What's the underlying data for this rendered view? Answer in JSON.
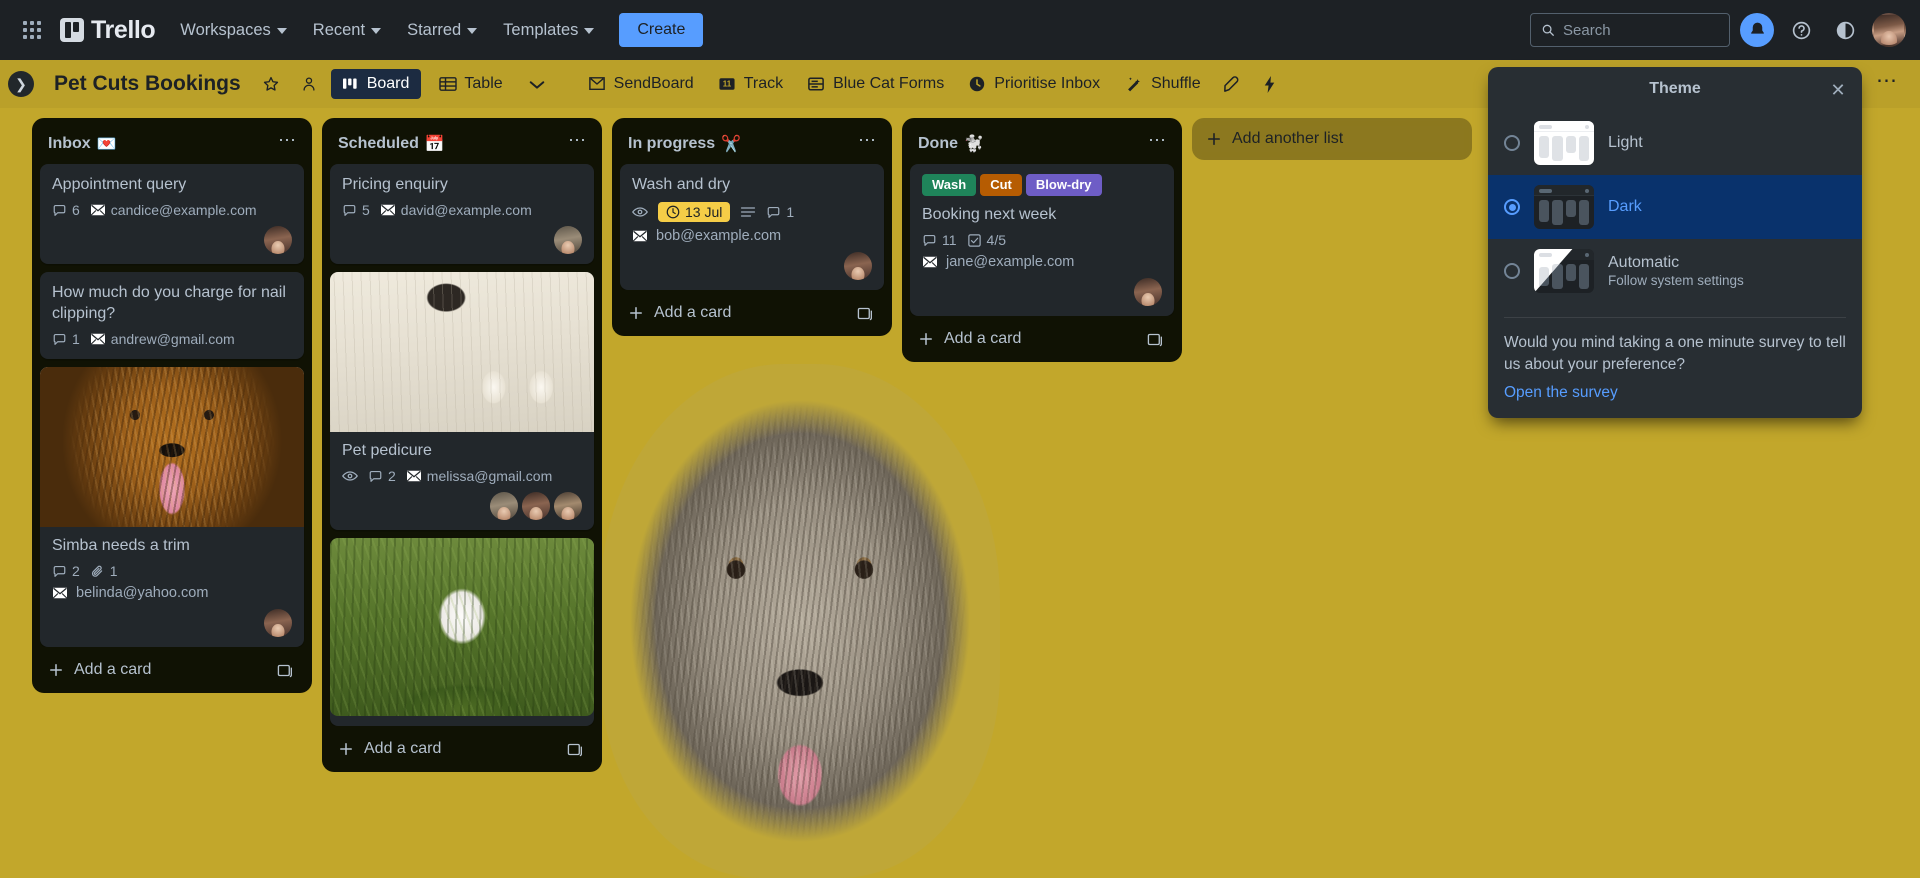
{
  "topnav": {
    "apps_icon": "grid-apps-icon",
    "brand": "Trello",
    "items": [
      {
        "label": "Workspaces",
        "has_chevron": true
      },
      {
        "label": "Recent",
        "has_chevron": true
      },
      {
        "label": "Starred",
        "has_chevron": true
      },
      {
        "label": "Templates",
        "has_chevron": true
      }
    ],
    "create_label": "Create",
    "search_placeholder": "Search",
    "search_value": "",
    "icons": {
      "notifications": "bell-icon",
      "help": "question-circle-icon",
      "theme": "half-circle-contrast-icon",
      "avatar": "user-avatar"
    }
  },
  "board_header": {
    "sidebar_toggle": "chevron-right-icon",
    "title": "Pet Cuts Bookings",
    "star_icon": "star-icon",
    "visibility_icon": "workspace-visible-icon",
    "views": [
      {
        "label": "Board",
        "icon": "board-icon",
        "selected": true
      },
      {
        "label": "Table",
        "icon": "table-icon",
        "selected": false
      }
    ],
    "views_chevron": "chevron-down-icon",
    "power_ups": [
      {
        "label": "SendBoard",
        "icon": "sendboard-icon"
      },
      {
        "label": "Track",
        "icon": "track-11-icon"
      },
      {
        "label": "Blue Cat Forms",
        "icon": "forms-icon"
      },
      {
        "label": "Prioritise Inbox",
        "icon": "clock-icon"
      },
      {
        "label": "Shuffle",
        "icon": "magic-wand-icon"
      }
    ],
    "trailing_icons": [
      {
        "name": "rocket-icon"
      },
      {
        "name": "lightning-automation-icon"
      }
    ],
    "more_menu": "board-menu-dots"
  },
  "theme_popup": {
    "title": "Theme",
    "close_icon": "close-icon",
    "options": [
      {
        "id": "light",
        "label": "Light",
        "sublabel": "",
        "selected": false
      },
      {
        "id": "dark",
        "label": "Dark",
        "sublabel": "",
        "selected": true
      },
      {
        "id": "automatic",
        "label": "Automatic",
        "sublabel": "Follow system settings",
        "selected": false
      }
    ],
    "survey_text": "Would you mind taking a one minute survey to tell us about your preference?",
    "survey_link": "Open the survey"
  },
  "board": {
    "background_color": "#c2a72b",
    "add_list_label": "Add another list",
    "lists": [
      {
        "name": "Inbox",
        "emoji": "💌",
        "menu": "⋯",
        "add_card_label": "Add a card",
        "cards": [
          {
            "title": "Appointment query",
            "cover": null,
            "labels": [],
            "comments": "6",
            "attachments": null,
            "checklist": null,
            "due": null,
            "email": "candice@example.com",
            "members": [
              "m2"
            ]
          },
          {
            "title": "How much do you charge for nail clipping?",
            "cover": null,
            "labels": [],
            "comments": "1",
            "attachments": null,
            "checklist": null,
            "due": null,
            "email": "andrew@gmail.com",
            "members": []
          },
          {
            "title": "Simba needs a trim",
            "cover": "dog-brown-cover",
            "labels": [],
            "comments": "2",
            "attachments": "1",
            "checklist": null,
            "due": null,
            "email": "belinda@yahoo.com",
            "members": [
              "m2"
            ]
          }
        ]
      },
      {
        "name": "Scheduled",
        "emoji": "📅",
        "menu": "⋯",
        "add_card_label": "Add a card",
        "cards": [
          {
            "title": "Pricing enquiry",
            "cover": null,
            "labels": [],
            "comments": "5",
            "attachments": null,
            "checklist": null,
            "due": null,
            "email": "david@example.com",
            "members": [
              "m1"
            ]
          },
          {
            "title": "Pet pedicure",
            "cover": "cat-paws-cover",
            "labels": [],
            "watching": true,
            "comments": "2",
            "attachments": null,
            "checklist": null,
            "due": null,
            "email": "melissa@gmail.com",
            "members": [
              "m1",
              "m2",
              "m3"
            ]
          },
          {
            "title": "",
            "cover": "puppy-grass-cover",
            "labels": [],
            "comments": null,
            "attachments": null,
            "checklist": null,
            "due": null,
            "email": "",
            "members": []
          }
        ]
      },
      {
        "name": "In progress",
        "emoji": "✂️",
        "menu": "⋯",
        "add_card_label": "Add a card",
        "cards": [
          {
            "title": "Wash and dry",
            "cover": null,
            "labels": [],
            "watching": true,
            "due": "13 Jul",
            "description": true,
            "comments": "1",
            "attachments": null,
            "checklist": null,
            "email": "bob@example.com",
            "members": [
              "m2"
            ]
          }
        ]
      },
      {
        "name": "Done",
        "emoji": "🐩",
        "menu": "⋯",
        "add_card_label": "Add a card",
        "cards": [
          {
            "title": "Booking next week",
            "cover": null,
            "labels": [
              {
                "text": "Wash",
                "color": "#1f845a"
              },
              {
                "text": "Cut",
                "color": "#b65c02"
              },
              {
                "text": "Blow-dry",
                "color": "#6e5dc6"
              }
            ],
            "comments": "11",
            "checklist": "4/5",
            "attachments": null,
            "due": null,
            "email": "jane@example.com",
            "members": [
              "m2"
            ]
          }
        ]
      }
    ]
  }
}
